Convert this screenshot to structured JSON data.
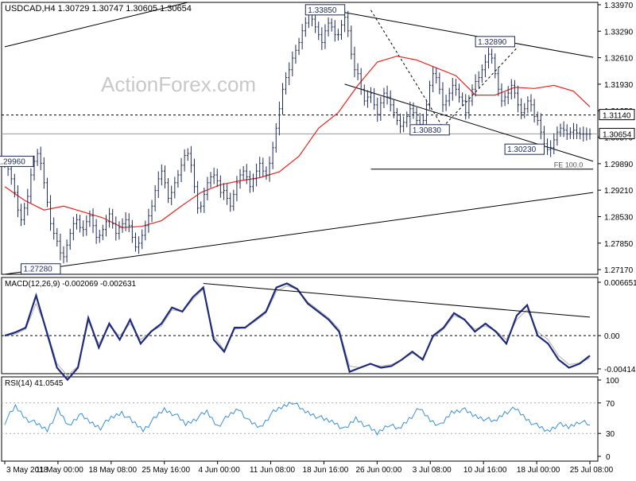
{
  "chart_data": {
    "type": "candlestick",
    "title": "USDCAD,H4  1.30729 1.30747 1.30605 1.30654",
    "watermark": "ActionForex.com",
    "price_ticks": [
      "1.33970",
      "1.33290",
      "1.32610",
      "1.31930",
      "1.31250",
      "1.30570",
      "1.29890",
      "1.29210",
      "1.28530",
      "1.27850",
      "1.27170"
    ],
    "price_range": [
      1.2705,
      1.3403
    ],
    "time_labels": [
      "3 May 2018",
      "11 May 00:00",
      "18 May 08:00",
      "25 May 16:00",
      "4 Jun 00:00",
      "11 Jun 08:00",
      "18 Jun 16:00",
      "26 Jun 00:00",
      "3 Jul 08:00",
      "10 Jul 16:00",
      "18 Jul 00:00",
      "25 Jul 08:00"
    ],
    "candle_count": 180,
    "closes": [
      1.299,
      1.2975,
      1.295,
      1.2915,
      1.287,
      1.2845,
      1.2875,
      1.2905,
      1.296,
      1.2995,
      1.3015,
      1.299,
      1.294,
      1.289,
      1.2835,
      1.281,
      1.279,
      1.276,
      1.275,
      1.278,
      1.281,
      1.2835,
      1.2845,
      1.2825,
      1.282,
      1.284,
      1.2855,
      1.283,
      1.28,
      1.2805,
      1.282,
      1.284,
      1.286,
      1.2835,
      1.281,
      1.2825,
      1.2835,
      1.2845,
      1.283,
      1.28,
      1.2775,
      1.2785,
      1.2805,
      1.283,
      1.2855,
      1.288,
      1.292,
      1.295,
      1.297,
      1.294,
      1.29,
      1.2915,
      1.294,
      1.296,
      1.2985,
      1.301,
      1.3015,
      1.2985,
      1.293,
      1.2875,
      1.288,
      1.291,
      1.294,
      1.2955,
      1.296,
      1.2945,
      1.2915,
      1.292,
      1.29,
      1.288,
      1.291,
      1.294,
      1.296,
      1.297,
      1.2955,
      1.293,
      1.295,
      1.297,
      1.299,
      1.297,
      1.296,
      1.299,
      1.303,
      1.308,
      1.313,
      1.318,
      1.321,
      1.323,
      1.326,
      1.328,
      1.33,
      1.333,
      1.335,
      1.3375,
      1.336,
      1.334,
      1.332,
      1.33,
      1.333,
      1.335,
      1.334,
      1.332,
      1.332,
      1.3345,
      1.3365,
      1.333,
      1.327,
      1.323,
      1.322,
      1.318,
      1.315,
      1.316,
      1.317,
      1.314,
      1.3115,
      1.3145,
      1.317,
      1.316,
      1.314,
      1.312,
      1.31,
      1.3085,
      1.3095,
      1.311,
      1.313,
      1.312,
      1.31,
      1.309,
      1.31,
      1.314,
      1.319,
      1.322,
      1.321,
      1.318,
      1.314,
      1.315,
      1.317,
      1.319,
      1.318,
      1.316,
      1.315,
      1.312,
      1.315,
      1.318,
      1.32,
      1.321,
      1.323,
      1.325,
      1.327,
      1.326,
      1.322,
      1.318,
      1.315,
      1.316,
      1.317,
      1.319,
      1.317,
      1.314,
      1.312,
      1.313,
      1.315,
      1.314,
      1.311,
      1.31,
      1.307,
      1.304,
      1.3025,
      1.303,
      1.305,
      1.307,
      1.308,
      1.3075,
      1.3065,
      1.307,
      1.3075,
      1.3068,
      1.3065,
      1.3065
    ],
    "moving_average": [
      1.293,
      1.2925,
      1.2915,
      1.2895,
      1.2875,
      1.287,
      1.2872,
      1.2878,
      1.288,
      1.2876,
      1.287,
      1.2865,
      1.286,
      1.285,
      1.284,
      1.283,
      1.2825,
      1.2823,
      1.2823,
      1.2828,
      1.2835,
      1.2843,
      1.2855,
      1.2868,
      1.288,
      1.2893,
      1.2905,
      1.2915,
      1.2925,
      1.2935,
      1.2942,
      1.2945,
      1.2945,
      1.2945,
      1.2948,
      1.2953,
      1.296,
      1.2968,
      1.2978,
      1.299,
      1.3008,
      1.303,
      1.3055,
      1.308,
      1.31,
      1.312,
      1.314,
      1.3165,
      1.319,
      1.321,
      1.323,
      1.325,
      1.326,
      1.3265,
      1.3265,
      1.3262,
      1.3255,
      1.3245,
      1.324,
      1.3235,
      1.3225,
      1.3215,
      1.32,
      1.318,
      1.3165,
      1.316,
      1.316,
      1.3165,
      1.3175,
      1.3185,
      1.319,
      1.3188,
      1.3182,
      1.3182,
      1.3188,
      1.319,
      1.3185,
      1.3175,
      1.316,
      1.3145,
      1.3135
    ],
    "ma_x_anchor": [
      0,
      6,
      12,
      18,
      24,
      30,
      36,
      42,
      48,
      54,
      60,
      66,
      72,
      78,
      84,
      90,
      96,
      102,
      108,
      114,
      120,
      126,
      132,
      138,
      144,
      150,
      156,
      162,
      168,
      174,
      180
    ],
    "annotations": {
      "high_1": "1.33850",
      "high_2": "1.32890",
      "low_1": "1.30830",
      "low_2": "1.30230",
      "low_3": "1.27280",
      "left_label": "1.29960",
      "fe_label": "FE 100.0",
      "current_price": "1.30654",
      "level_label": "1.31140"
    },
    "macd": {
      "label": "MACD(12,26,9) -0.002069 -0.002631",
      "ticks": [
        "0.006651",
        "0.00",
        "-0.004145"
      ],
      "range": [
        -0.004145,
        0.006651
      ],
      "macd_anchor": [
        0.0,
        0.0004,
        0.001,
        0.005,
        0.0005,
        -0.004,
        -0.0055,
        -0.004,
        0.0022,
        -0.0015,
        0.0015,
        -0.0005,
        0.002,
        -0.001,
        0.0005,
        0.0015,
        0.0035,
        0.003,
        0.0048,
        0.006,
        -0.0005,
        -0.002,
        0.001,
        0.001,
        0.002,
        0.003,
        0.006,
        0.0065,
        0.0058,
        0.004,
        0.003,
        0.002,
        0.0005,
        -0.0045,
        -0.004,
        -0.0035,
        -0.004,
        -0.0038,
        -0.003,
        -0.002,
        -0.003,
        0.0,
        0.001,
        0.0028,
        0.002,
        0.0005,
        0.0015,
        0.0005,
        -0.001,
        0.0025,
        0.0038,
        0.0,
        -0.001,
        -0.003,
        -0.004,
        -0.0035,
        -0.0025
      ],
      "signal_anchor": [
        0.0,
        0.0002,
        0.0008,
        0.004,
        0.0008,
        -0.0035,
        -0.005,
        -0.0038,
        0.0018,
        -0.001,
        0.0012,
        0.0,
        0.0015,
        -0.0005,
        0.0005,
        0.0012,
        0.0032,
        0.003,
        0.0045,
        0.0058,
        0.0,
        -0.0018,
        0.0008,
        0.001,
        0.0018,
        0.0028,
        0.0055,
        0.0062,
        0.0058,
        0.0042,
        0.0032,
        0.0022,
        0.0008,
        -0.0038,
        -0.004,
        -0.0036,
        -0.0038,
        -0.0036,
        -0.003,
        -0.0022,
        -0.0028,
        -0.0002,
        0.0008,
        0.0025,
        0.002,
        0.0008,
        0.0012,
        0.0006,
        -0.0005,
        0.002,
        0.0032,
        0.0005,
        -0.0005,
        -0.0025,
        -0.0036,
        -0.0034,
        -0.0028
      ]
    },
    "rsi": {
      "label": "RSI(14) 41.0545",
      "ticks": [
        "100",
        "70",
        "30",
        "0"
      ],
      "range": [
        0,
        100
      ],
      "anchor": [
        45,
        65,
        50,
        42,
        35,
        60,
        40,
        55,
        45,
        38,
        50,
        58,
        45,
        35,
        48,
        62,
        55,
        42,
        50,
        58,
        40,
        52,
        63,
        45,
        38,
        55,
        64,
        72,
        60,
        55,
        48,
        45,
        35,
        50,
        40,
        30,
        42,
        35,
        50,
        62,
        48,
        40,
        58,
        62,
        54,
        50,
        45,
        58,
        62,
        50,
        40,
        33,
        42,
        38,
        46,
        41
      ]
    }
  }
}
